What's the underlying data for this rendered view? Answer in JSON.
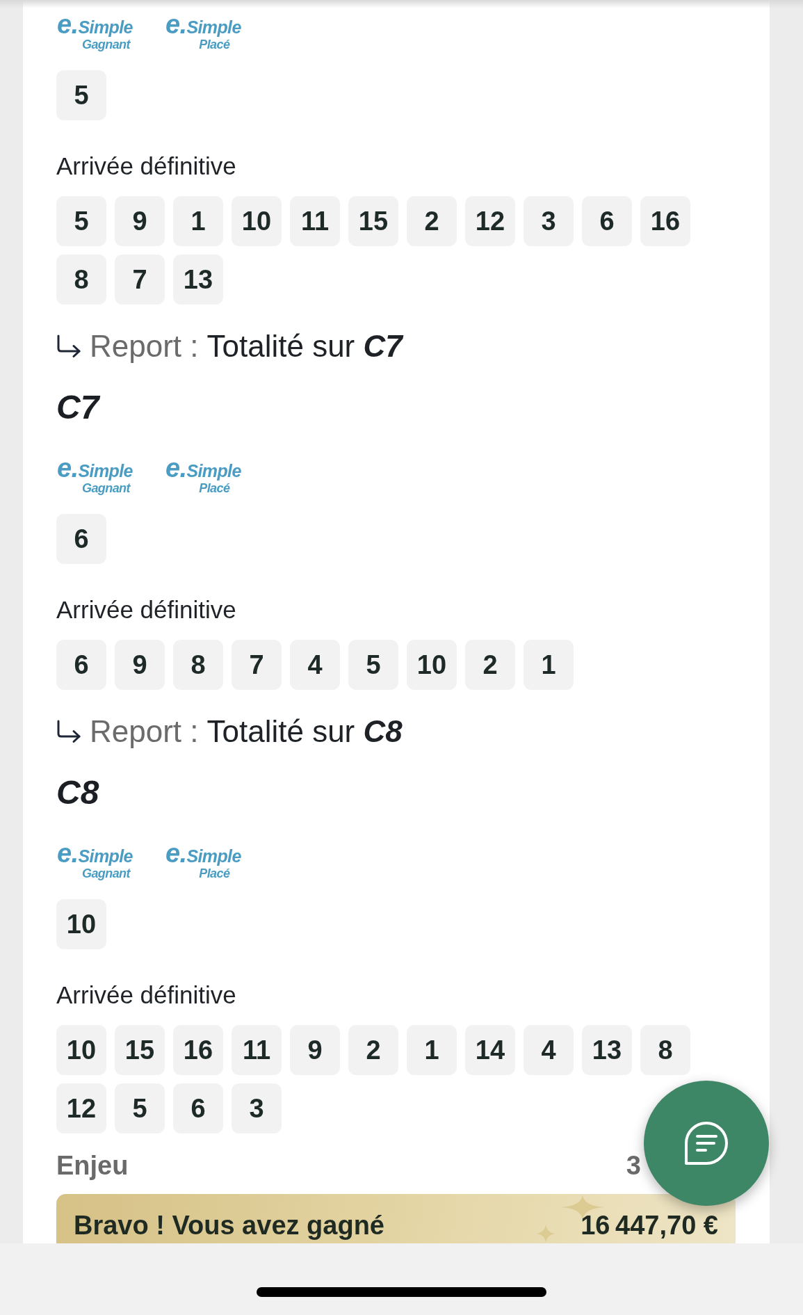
{
  "races": [
    {
      "bet_types": [
        {
          "brand": "e.Simple",
          "label": "Gagnant"
        },
        {
          "brand": "e.Simple",
          "label": "Placé"
        }
      ],
      "selection": [
        "5"
      ],
      "result_label": "Arrivée définitive",
      "result": [
        "5",
        "9",
        "1",
        "10",
        "11",
        "15",
        "2",
        "12",
        "3",
        "6",
        "16",
        "8",
        "7",
        "13"
      ],
      "carryover": {
        "label": "Report :",
        "text": "Totalité sur",
        "target": "C7"
      }
    },
    {
      "title": "C7",
      "bet_types": [
        {
          "brand": "e.Simple",
          "label": "Gagnant"
        },
        {
          "brand": "e.Simple",
          "label": "Placé"
        }
      ],
      "selection": [
        "6"
      ],
      "result_label": "Arrivée définitive",
      "result": [
        "6",
        "9",
        "8",
        "7",
        "4",
        "5",
        "10",
        "2",
        "1"
      ],
      "carryover": {
        "label": "Report :",
        "text": "Totalité sur",
        "target": "C8"
      }
    },
    {
      "title": "C8",
      "bet_types": [
        {
          "brand": "e.Simple",
          "label": "Gagnant"
        },
        {
          "brand": "e.Simple",
          "label": "Placé"
        }
      ],
      "selection": [
        "10"
      ],
      "result_label": "Arrivée définitive",
      "result": [
        "10",
        "15",
        "16",
        "11",
        "9",
        "2",
        "1",
        "14",
        "4",
        "13",
        "8",
        "12",
        "5",
        "6",
        "3"
      ]
    }
  ],
  "stake": {
    "label": "Enjeu",
    "value": "3"
  },
  "win_banner": {
    "text": "Bravo ! Vous avez gagné",
    "amount": "16 447,70 €"
  }
}
